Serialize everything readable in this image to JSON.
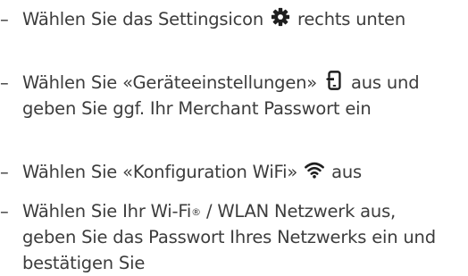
{
  "steps": [
    {
      "dash": "–",
      "before_icon": "Wählen Sie das Settingsicon",
      "icon": "gear-icon",
      "after_icon": "rechts unten"
    },
    {
      "dash": "–",
      "before_icon": "Wählen Sie «Geräteeinstellungen»",
      "icon": "device-settings-icon",
      "after_icon": "aus und",
      "line2": "geben Sie ggf. Ihr Merchant Passwort ein"
    },
    {
      "dash": "–",
      "before_icon": "Wählen Sie «Konfiguration WiFi»",
      "icon": "wifi-icon",
      "after_icon": "aus"
    },
    {
      "dash": "–",
      "line1_part1": "Wählen Sie Ihr Wi-Fi",
      "registered": "®",
      "line1_part2": "/ WLAN Netzwerk aus,",
      "line2": "geben Sie das Passwort Ihres Netzwerks ein und",
      "line3": "bestätigen Sie"
    }
  ],
  "colors": {
    "text": "#3c3c3c",
    "icon": "#1e1e1e"
  }
}
